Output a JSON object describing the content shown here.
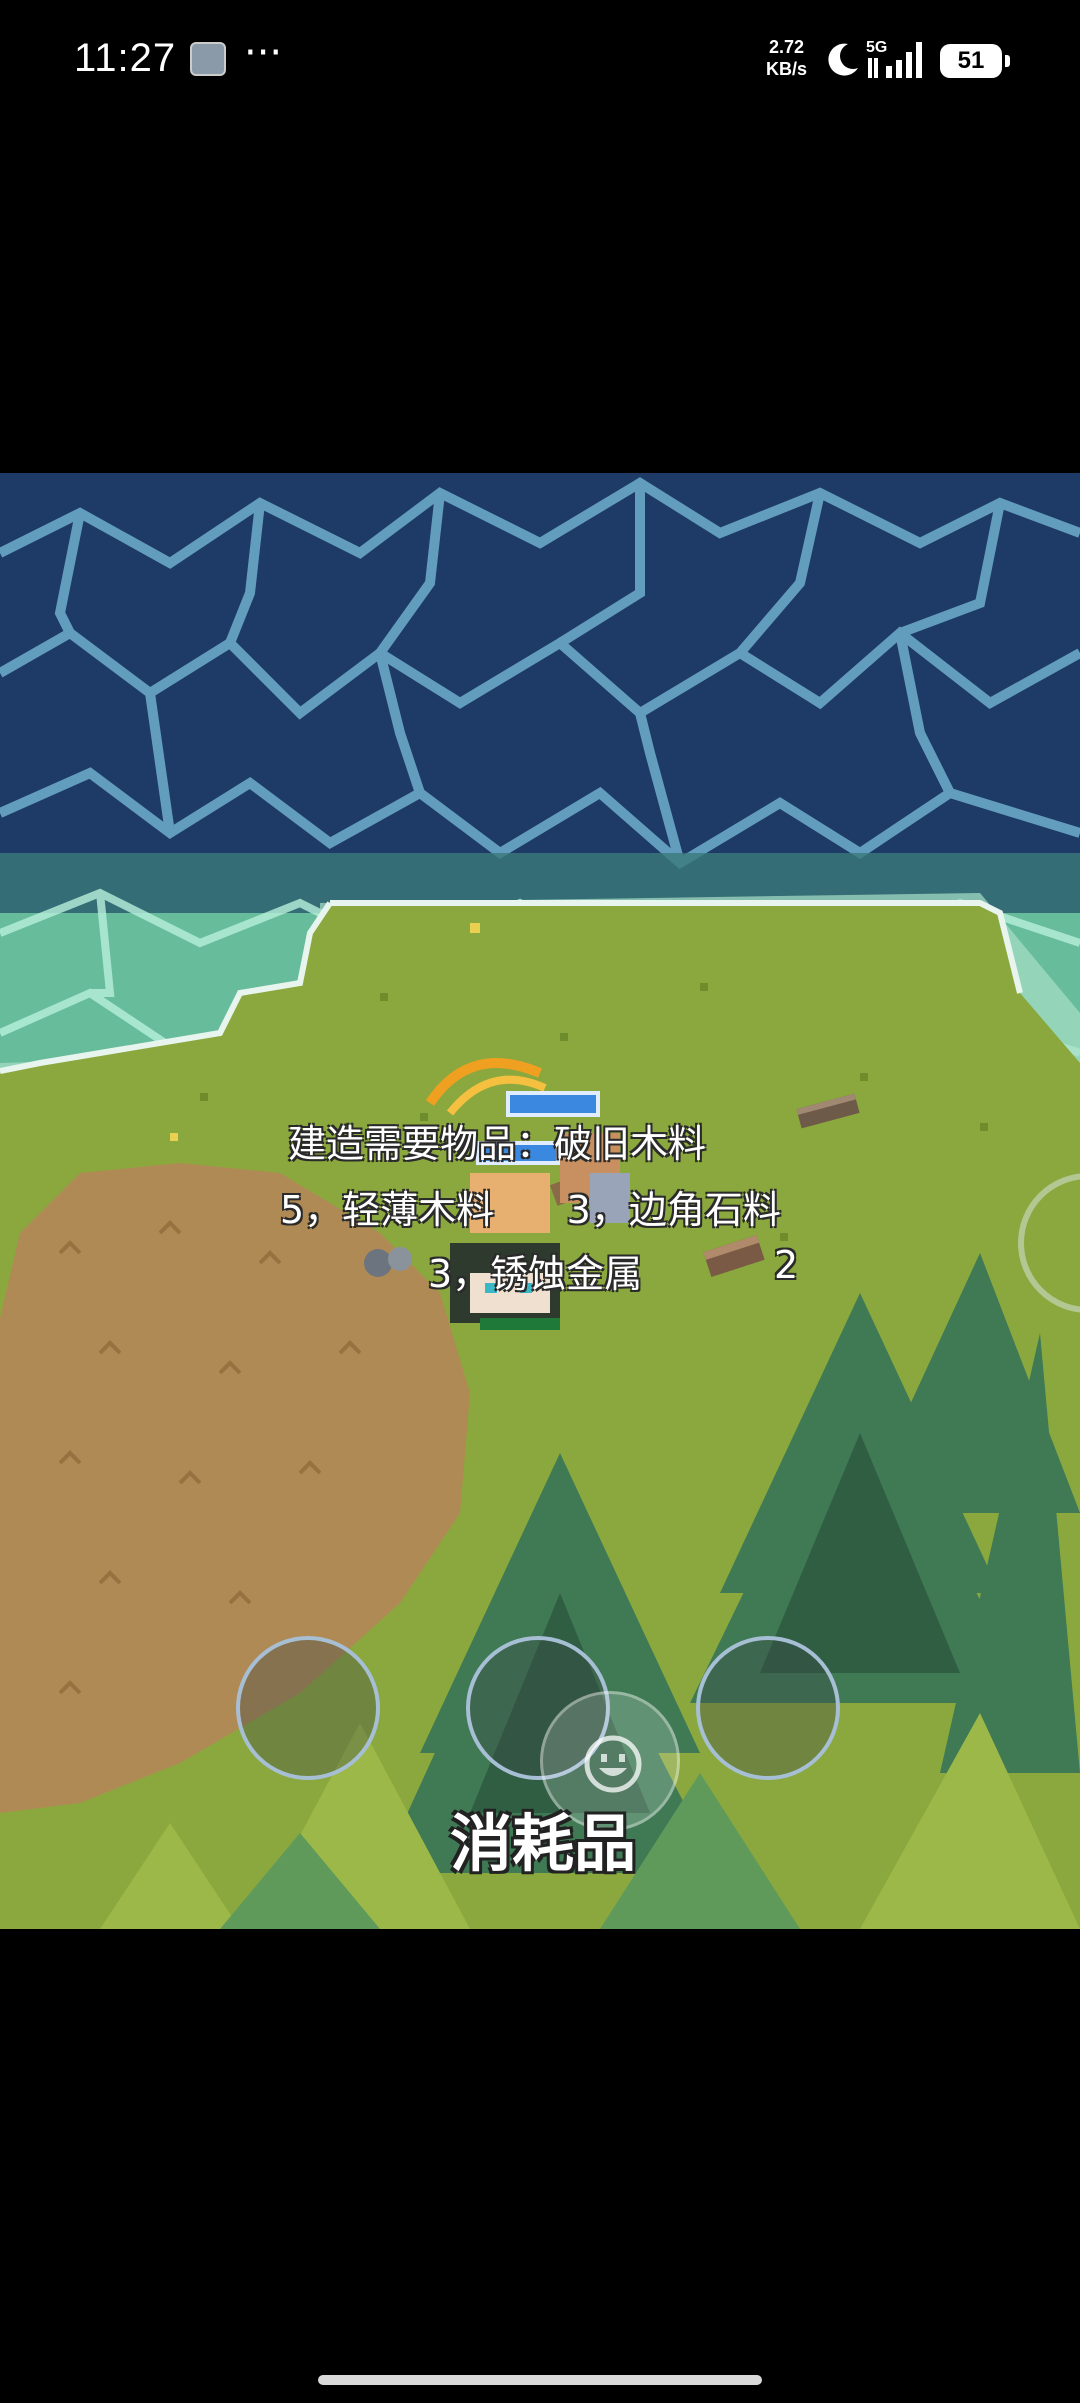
{
  "status_bar": {
    "time": "11:27",
    "more": "···",
    "net_speed_value": "2.72",
    "net_speed_unit": "KB/s",
    "network_type": "5G",
    "battery": "51"
  },
  "game": {
    "build_requirements": {
      "line1": "建造需要物品：破旧木料",
      "line2": "5，轻薄木料      3，边角石料",
      "line3_count_a": "3，锈蚀金属",
      "line3_count_b": "2"
    },
    "consumables_label": "消耗品"
  },
  "colors": {
    "deep_water": "#1e3a66",
    "foam": "#a8d8d0",
    "grass": "#8aa83e",
    "dirt": "#b08a55",
    "tree_dark": "#3f7a55",
    "tree_light": "#9cb848"
  }
}
